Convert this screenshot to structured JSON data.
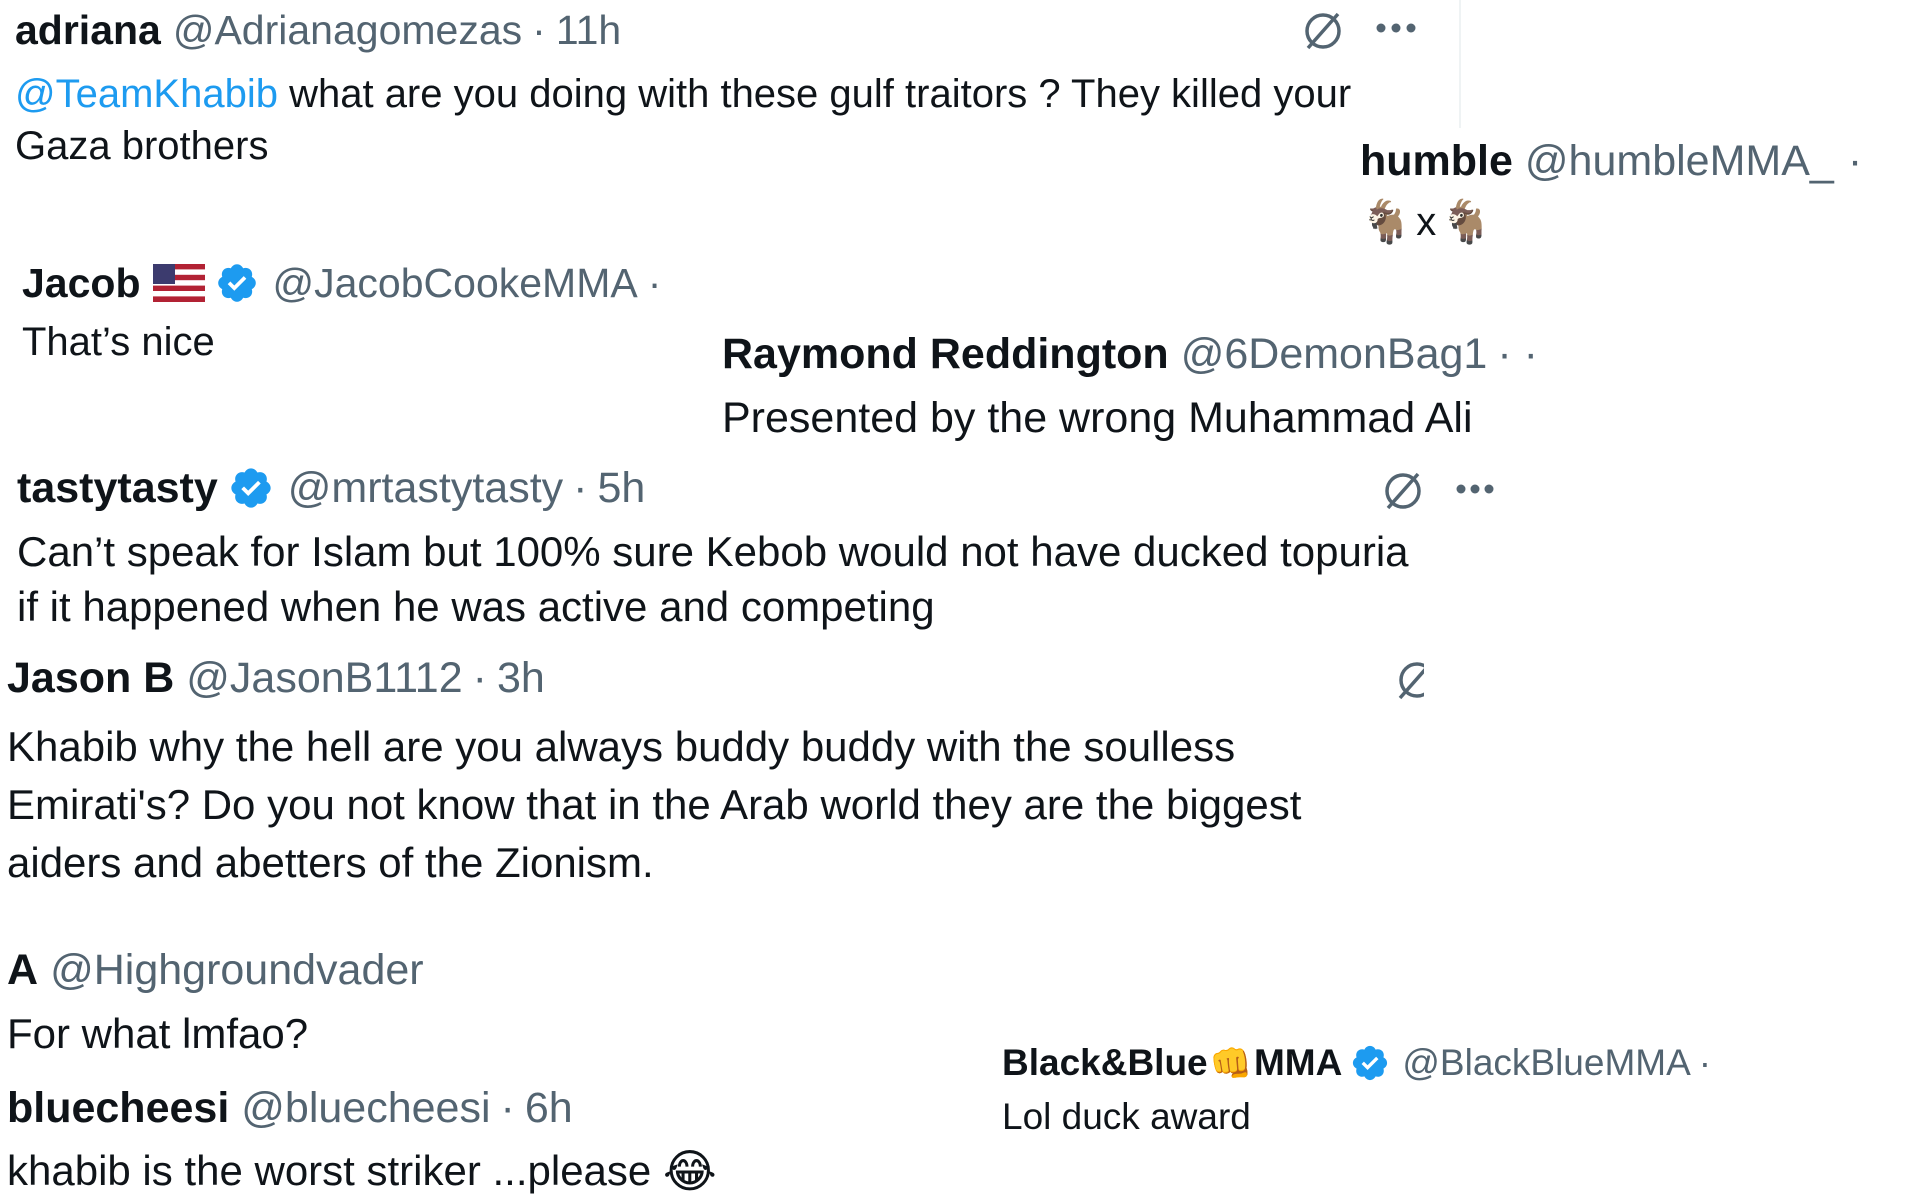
{
  "colors": {
    "text": "#0f1419",
    "secondary": "#536471",
    "link": "#1d9bf0",
    "verified": "#1d9bf0"
  },
  "tweets": [
    {
      "name": "adriana",
      "handle": "@Adrianagomezas",
      "sep": "·",
      "time": "11h",
      "mention": "@TeamKhabib",
      "text": " what are you doing with these gulf traitors ? They killed your",
      "text2": "Gaza brothers",
      "icons": [
        "grok-icon",
        "more-icon"
      ]
    },
    {
      "name": "humble",
      "handle": "@humbleMMA_",
      "sep": "·",
      "emoji_left": "🐐",
      "text": "x",
      "emoji_right": "🐐",
      "emoji_names": [
        "goat-emoji-left",
        "goat-emoji-right"
      ]
    },
    {
      "name": "Jacob",
      "handle": "@JacobCookeMMA",
      "sep": "·",
      "text": "That’s nice",
      "icons": [
        "us-flag-icon",
        "verified-badge-icon"
      ]
    },
    {
      "name": "Raymond Reddington",
      "handle": "@6DemonBag1",
      "sep": "· ·",
      "text": "Presented by the wrong Muhammad Ali"
    },
    {
      "name": "tastytasty",
      "handle": "@mrtastytasty",
      "sep": "·",
      "time": "5h",
      "text": "Can’t speak for Islam but 100% sure Kebob would not have ducked topuria",
      "text2": "if it happened when he was active and competing",
      "icons": [
        "verified-badge-icon",
        "grok-icon",
        "more-icon"
      ]
    },
    {
      "name": "Jason B",
      "handle": "@JasonB1112",
      "sep": "·",
      "time": "3h",
      "text": "Khabib why the hell are you always buddy buddy with the soulless",
      "text2": "Emirati's? Do you not know that in the Arab world they are the biggest",
      "text3": "aiders and abetters of the Zionism.",
      "icons": [
        "grok-icon"
      ]
    },
    {
      "name": "A",
      "handle": "@Highgroundvader",
      "text": "For what lmfao?"
    },
    {
      "name": "bluecheesi",
      "handle": "@bluecheesi",
      "sep": "·",
      "time": "6h",
      "text": "khabib is the worst striker ...please ",
      "emoji": "😂",
      "emoji_name": "tears-of-joy-emoji"
    },
    {
      "name_a": "Black&Blue",
      "name_emoji": "👊",
      "name_b": "MMA",
      "handle": "@BlackBlueMMA",
      "sep": "·",
      "text": "Lol duck award",
      "icons": [
        "fist-emoji",
        "verified-badge-icon"
      ]
    }
  ]
}
